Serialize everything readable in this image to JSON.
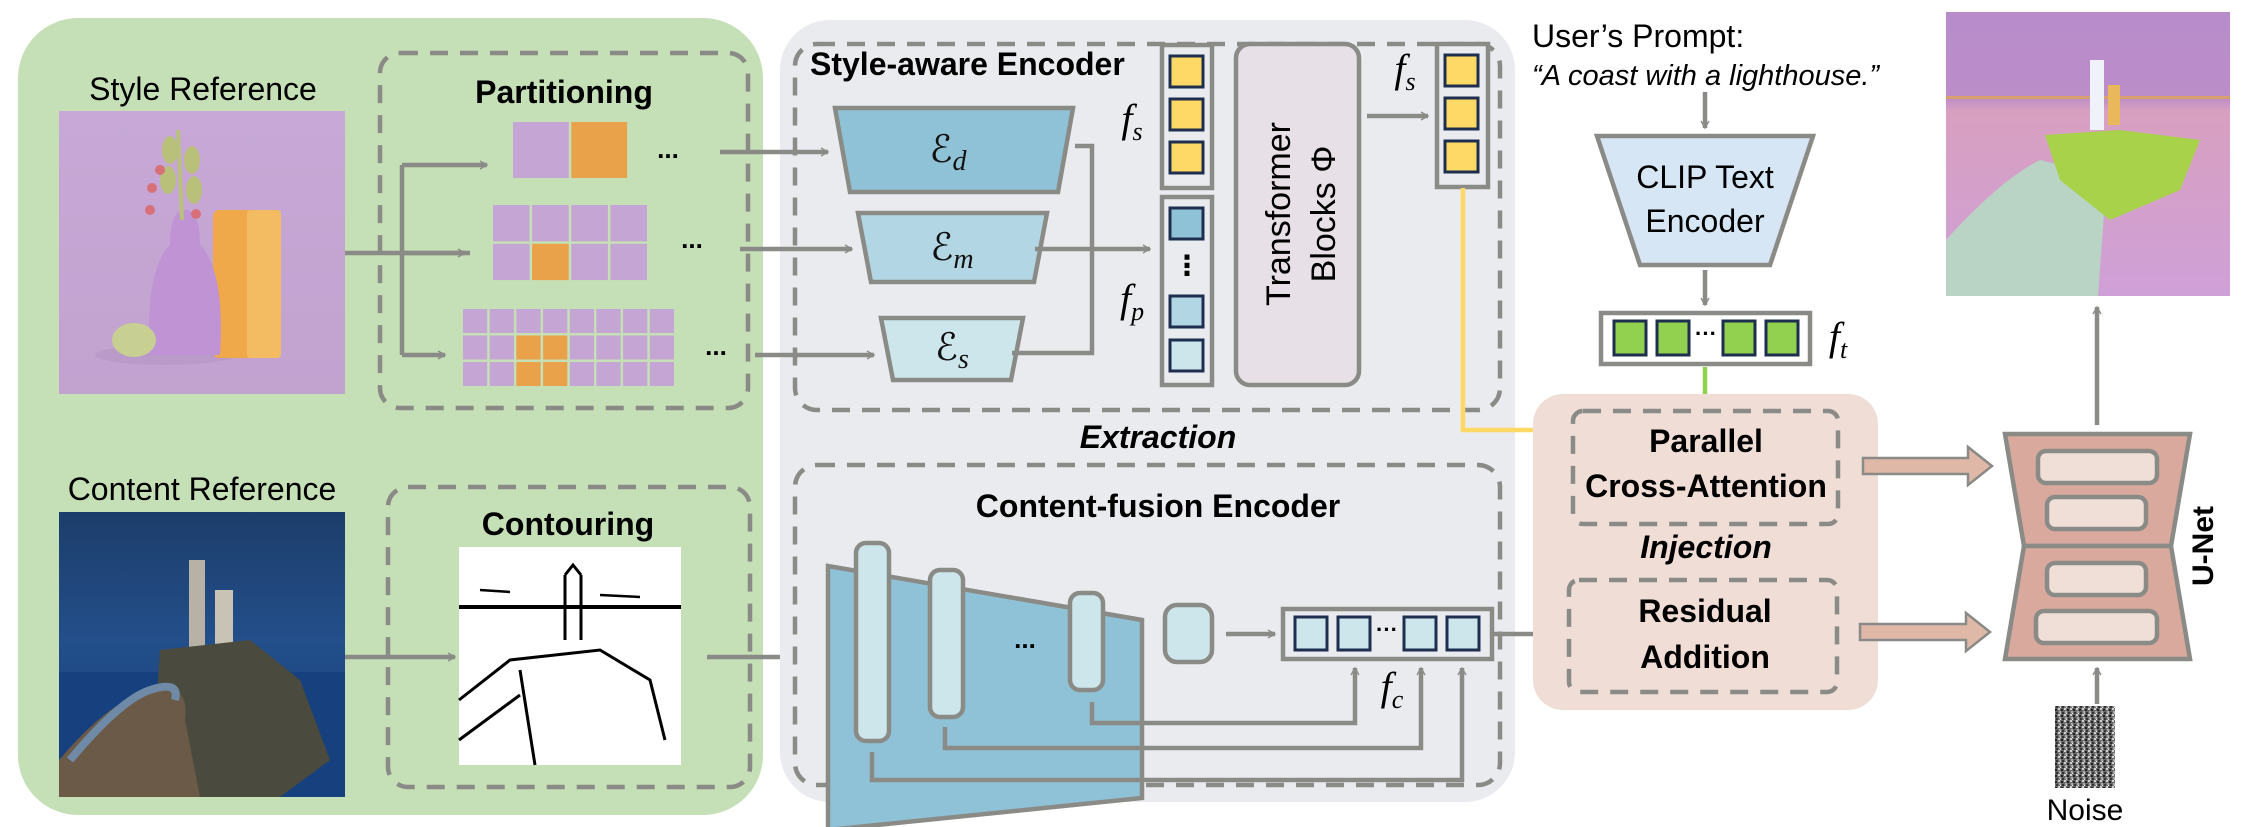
{
  "figure": {
    "style_reference": {
      "label": "Style Reference"
    },
    "partitioning": {
      "title": "Partitioning",
      "ellipsis": "..."
    },
    "content_reference": {
      "label": "Content Reference"
    },
    "contouring": {
      "title": "Contouring"
    },
    "style_encoder": {
      "title": "Style-aware Encoder",
      "encoders": [
        {
          "symbol": "ℰ",
          "subscript": "d",
          "fill": "#8fc2d6"
        },
        {
          "symbol": "ℰ",
          "subscript": "m",
          "fill": "#b2d6e4"
        },
        {
          "symbol": "ℰ",
          "subscript": "s",
          "fill": "#cde6ec"
        }
      ],
      "fs_label": "f",
      "fs_sub": "s",
      "fp_label": "f",
      "fp_sub": "p",
      "fp_dots": "⋮",
      "transformer_line1": "Transformer",
      "transformer_line2": "Blocks Φ",
      "out_label": "f",
      "out_sub": "s"
    },
    "extraction_label": "Extraction",
    "content_encoder": {
      "title": "Content-fusion Encoder",
      "ellipsis": "...",
      "fc_label": "f",
      "fc_sub": "c",
      "token_dots": "···"
    },
    "prompt": {
      "heading": "User’s Prompt:",
      "text": "“A coast with a lighthouse.”"
    },
    "clip": {
      "line1": "CLIP Text",
      "line2": "Encoder"
    },
    "text_tokens": {
      "label": "f",
      "sub": "t",
      "dots": "···"
    },
    "injection": {
      "label": "Injection",
      "cross_attention_line1": "Parallel",
      "cross_attention_line2": "Cross-Attention",
      "residual_line1": "Residual",
      "residual_line2": "Addition"
    },
    "unet": {
      "label": "U-Net"
    },
    "noise": {
      "label": "Noise"
    },
    "colors": {
      "green_panel": "#c5dfb6",
      "gray_panel": "#eaebef",
      "injection_panel": "#f0ddd6",
      "style_token": "#ffd966",
      "text_token": "#92d050",
      "content_token": "#cde6ec",
      "connector": "#8a8b86",
      "style_flow": "#ffd966",
      "text_flow": "#92d050",
      "unet_fill": "#d9a99e",
      "unet_block": "#efdfd7",
      "transformer_fill": "#e8e0e7"
    }
  }
}
